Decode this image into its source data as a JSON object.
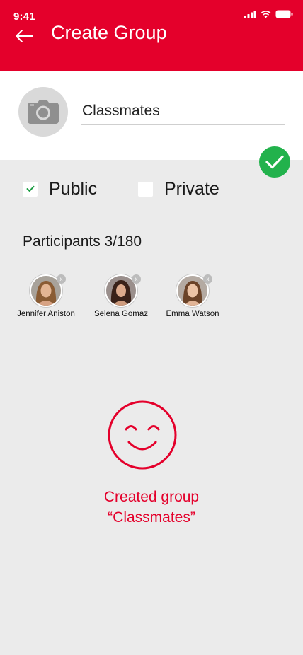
{
  "colors": {
    "accent": "#e4002b",
    "green": "#22b24c",
    "check": "#1e9e45"
  },
  "status_bar": {
    "time": "9:41",
    "icons": [
      "signal-icon",
      "wifi-icon",
      "battery-icon"
    ]
  },
  "header": {
    "title": "Create Group",
    "back_icon": "back-arrow-icon"
  },
  "group": {
    "name": "Classmates",
    "photo_icon": "camera-icon",
    "confirm_icon": "checkmark-icon"
  },
  "privacy": {
    "options": [
      {
        "label": "Public",
        "checked": true
      },
      {
        "label": "Private",
        "checked": false
      }
    ]
  },
  "participants": {
    "title": "Participants 3/180",
    "remove_label": "x",
    "list": [
      {
        "name": "Jennifer Aniston"
      },
      {
        "name": "Selena Gomaz"
      },
      {
        "name": "Emma Watson"
      }
    ]
  },
  "result": {
    "icon": "smiley-icon",
    "line1": "Created group",
    "line2": "“Classmates”"
  }
}
